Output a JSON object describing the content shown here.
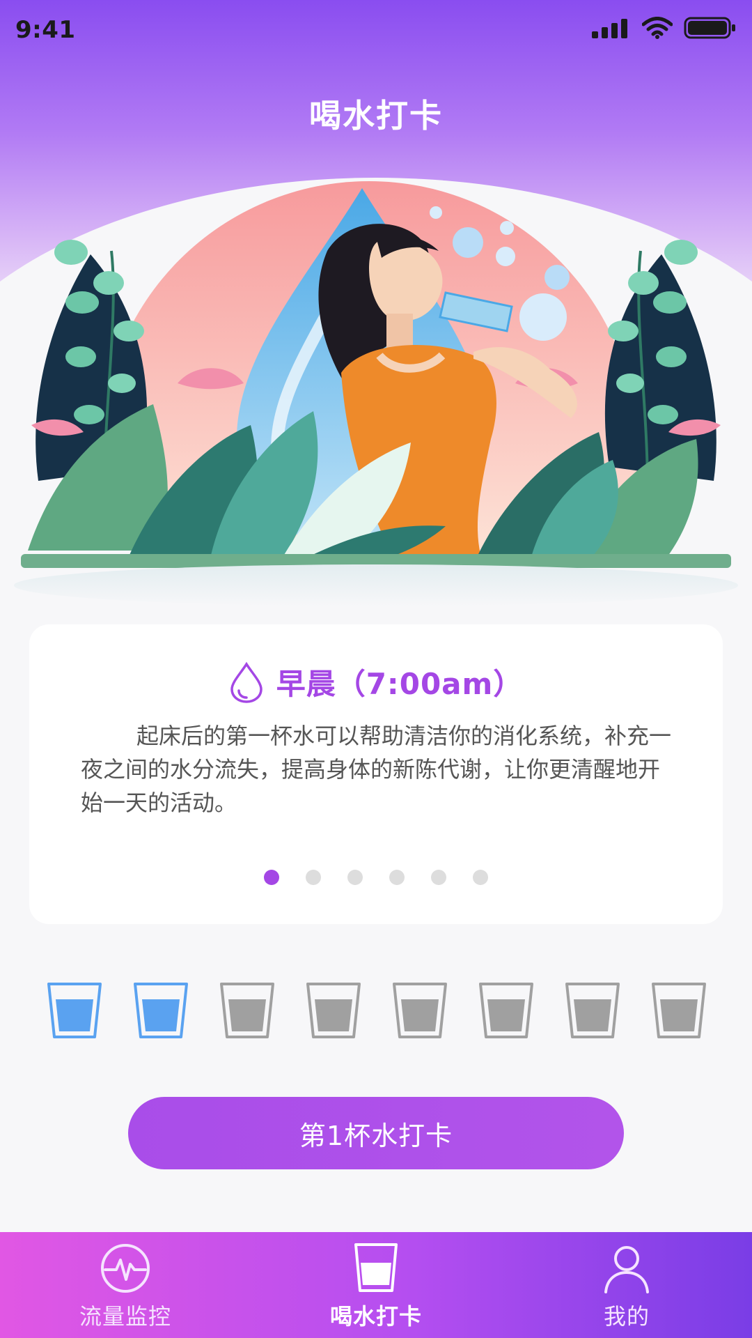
{
  "status_bar": {
    "time": "9:41",
    "icons": [
      "signal-icon",
      "wifi-icon",
      "battery-icon"
    ]
  },
  "header": {
    "title": "喝水打卡"
  },
  "tip_card": {
    "icon": "water-drop-icon",
    "title": "早晨（7:00am）",
    "body": "起床后的第一杯水可以帮助清洁你的消化系统，补充一夜之间的水分流失，提高身体的新陈代谢，让你更清醒地开始一天的活动。",
    "page_count": 6,
    "active_page": 1
  },
  "cups": {
    "total": 8,
    "filled": 2,
    "filled_color": "#5aa2f0",
    "empty_color": "#a0a0a0"
  },
  "checkin_button": {
    "label": "第1杯水打卡"
  },
  "tab_bar": {
    "tabs": [
      {
        "label": "流量监控",
        "icon": "pulse-monitor-icon",
        "active": false
      },
      {
        "label": "喝水打卡",
        "icon": "water-cup-icon",
        "active": true
      },
      {
        "label": "我的",
        "icon": "user-icon",
        "active": false
      }
    ]
  },
  "colors": {
    "accent": "#a447e5",
    "header_top": "#8a4df0",
    "tab_bar_left": "#e157e4",
    "tab_bar_right": "#7a3de6"
  }
}
